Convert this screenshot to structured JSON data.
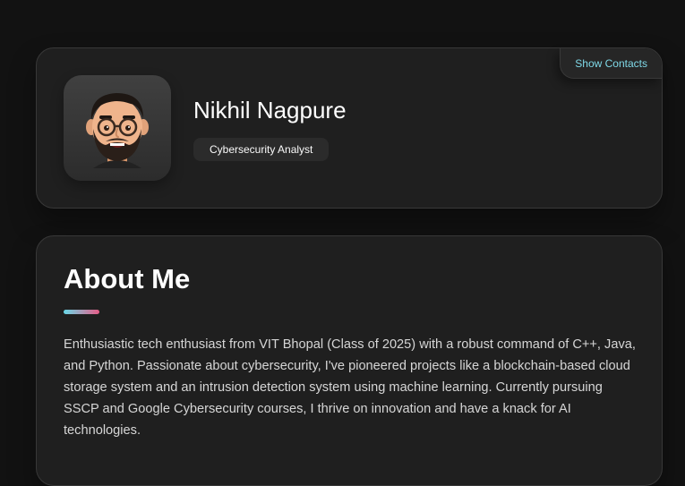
{
  "profile": {
    "name": "Nikhil Nagpure",
    "role": "Cybersecurity Analyst",
    "avatar_icon": "memoji-avatar-icon",
    "contacts_button_label": "Show Contacts"
  },
  "about": {
    "heading": "About Me",
    "text": "Enthusiastic tech enthusiast from VIT Bhopal (Class of 2025) with a robust command of C++, Java, and Python. Passionate about cybersecurity, I've pioneered projects like a blockchain-based cloud storage system and an intrusion detection system using machine learning. Currently pursuing SSCP and Google Cybersecurity courses, I thrive on innovation and have a knack for AI technologies."
  },
  "colors": {
    "background": "#121212",
    "card": "#1f1f1f",
    "accent_teal": "#68d9e8",
    "accent_pink": "#e75c87",
    "contacts_text": "#7fd9e8"
  }
}
